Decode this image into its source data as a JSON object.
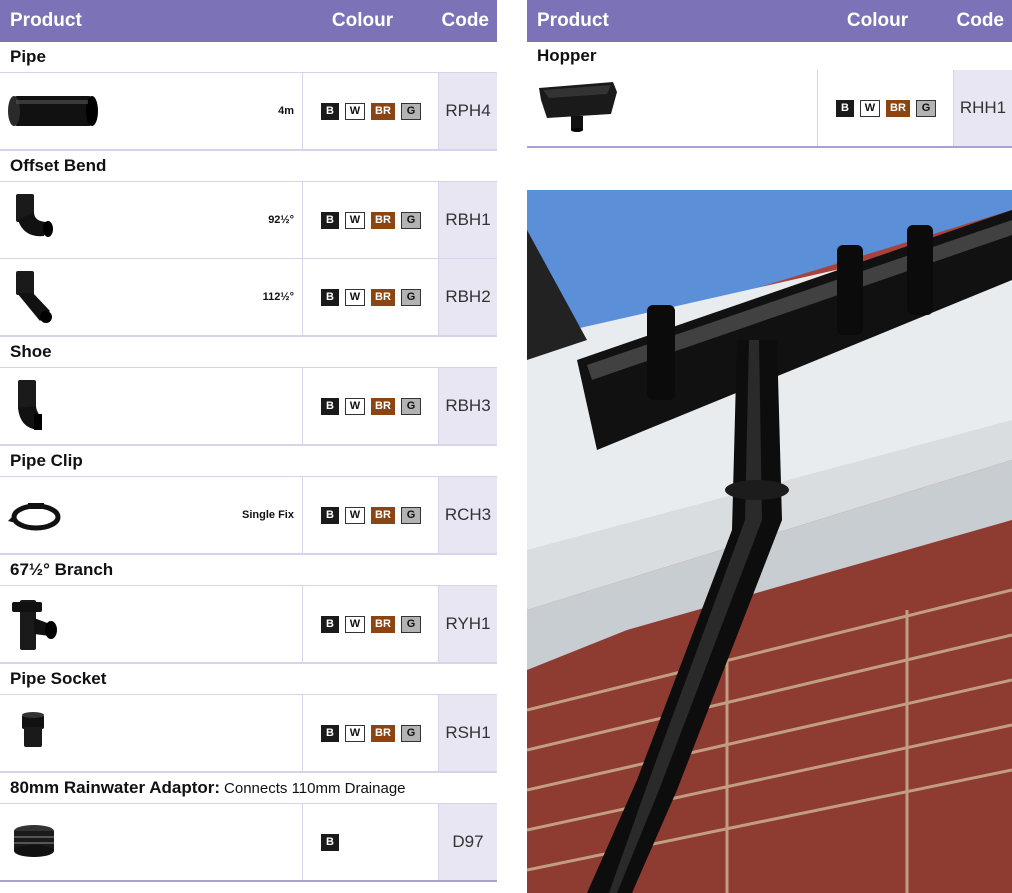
{
  "left": {
    "header": {
      "product": "Product",
      "colour": "Colour",
      "code": "Code"
    },
    "pipe": {
      "title": "Pipe",
      "spec": "4m",
      "code": "RPH4"
    },
    "offset": {
      "title": "Offset Bend",
      "r1_spec": "92½°",
      "r1_code": "RBH1",
      "r2_spec": "112½°",
      "r2_code": "RBH2"
    },
    "shoe": {
      "title": "Shoe",
      "code": "RBH3"
    },
    "clip": {
      "title": "Pipe Clip",
      "spec": "Single Fix",
      "code": "RCH3"
    },
    "branch": {
      "title": "67½° Branch",
      "code": "RYH1"
    },
    "socket": {
      "title": "Pipe Socket",
      "code": "RSH1"
    },
    "adaptor": {
      "title": "80mm Rainwater Adaptor:",
      "note": "Connects 110mm Drainage",
      "code": "D97"
    }
  },
  "right": {
    "header": {
      "product": "Product",
      "colour": "Colour",
      "code": "Code"
    },
    "hopper": {
      "title": "Hopper",
      "code": "RHH1"
    }
  },
  "swatches": {
    "b": "B",
    "w": "W",
    "br": "BR",
    "g": "G"
  },
  "colors": {
    "accent": "#7b72b8",
    "code_bg": "#e8e6f3",
    "black": "#1a1a1a",
    "brown": "#8b4513",
    "grey": "#b3b3b3"
  },
  "icons": [
    "pipe-icon",
    "offset-bend-92-icon",
    "offset-bend-112-icon",
    "shoe-icon",
    "pipe-clip-icon",
    "branch-icon",
    "pipe-socket-icon",
    "adaptor-icon",
    "hopper-icon"
  ]
}
